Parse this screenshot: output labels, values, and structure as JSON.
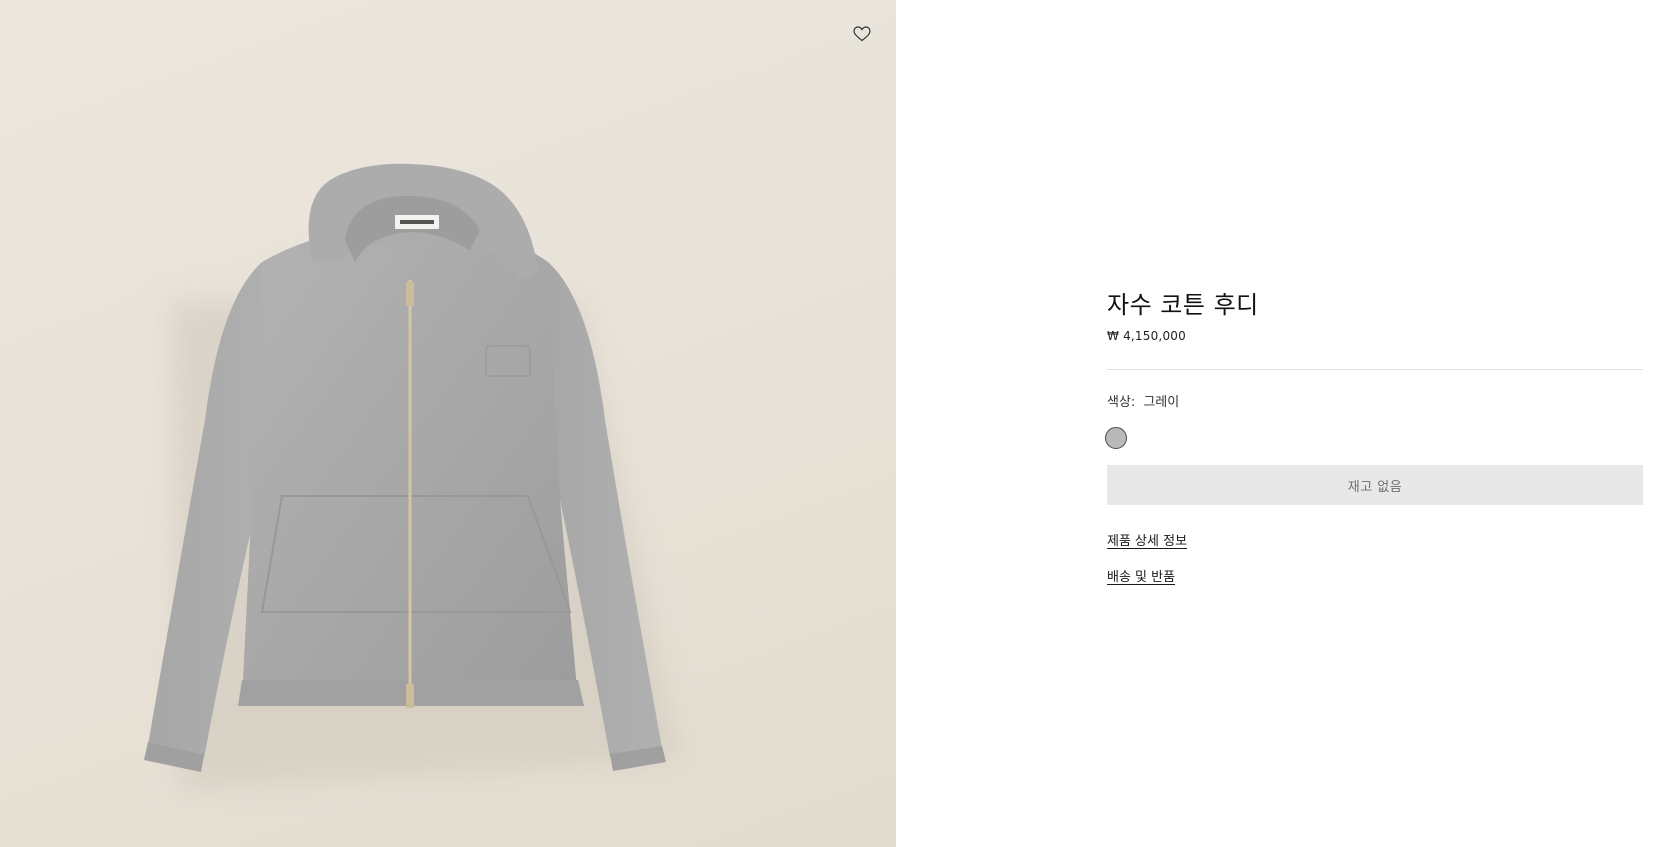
{
  "product": {
    "title": "자수 코튼 후디",
    "price": "₩ 4,150,000",
    "color_label": "색상:",
    "color_value": "그레이",
    "swatch_color": "#b9b9b9",
    "sold_out_label": "재고 없음"
  },
  "links": {
    "details": "제품 상세 정보",
    "shipping": "배송 및 반품"
  },
  "image": {
    "background_color": "#e9e4db",
    "garment_color": "#a6a6a6",
    "zipper_color": "#d3c6a8"
  },
  "icons": {
    "wishlist": "heart-icon"
  }
}
